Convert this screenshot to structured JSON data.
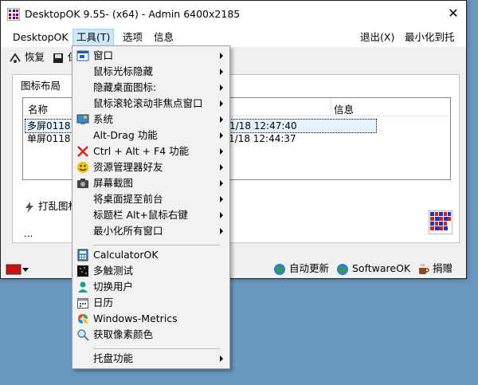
{
  "window": {
    "title": "DesktopOK 9.55- (x64) - Admin 6400x2185",
    "close_glyph": "✕"
  },
  "menubar": {
    "items": [
      "DesktopOK",
      "工具(T)",
      "选项",
      "信息"
    ],
    "right": [
      "退出(X)",
      "最小化到托盘"
    ]
  },
  "toolbar": {
    "restore": "恢复",
    "save_partial": "保"
  },
  "panel": {
    "title": "图标布局",
    "columns": [
      "名称",
      "信息"
    ],
    "rows": [
      {
        "name": "多屏0118",
        "date": "1/18 12:47:40"
      },
      {
        "name": "单屏0118",
        "date": "1/18 12:44:37"
      }
    ],
    "shuffle_partial": "打乱图标",
    "ellipsis": "..."
  },
  "status": {
    "auto_update": "自动更新",
    "softwareok": "SoftwareOK",
    "donate": "捐赠"
  },
  "menu": {
    "group1": [
      {
        "label": "窗口",
        "submenu": true,
        "icon": "window-icon"
      },
      {
        "label": "鼠标光标隐藏",
        "submenu": true,
        "icon": ""
      },
      {
        "label": "隐藏桌面图标:",
        "submenu": true,
        "icon": ""
      },
      {
        "label": "鼠标滚轮滚动非焦点窗口",
        "submenu": true,
        "icon": ""
      },
      {
        "label": "系统",
        "submenu": true,
        "icon": "system-icon"
      },
      {
        "label": "Alt-Drag 功能",
        "submenu": true,
        "icon": ""
      },
      {
        "label": "Ctrl + Alt + F4 功能",
        "submenu": true,
        "icon": "red-x-icon"
      },
      {
        "label": "资源管理器好友",
        "submenu": true,
        "icon": "explorer-friend-icon"
      },
      {
        "label": "屏幕截图",
        "submenu": true,
        "icon": "camera-icon"
      },
      {
        "label": "将桌面提至前台",
        "submenu": true,
        "icon": ""
      },
      {
        "label": "标题栏 Alt+鼠标右键",
        "submenu": true,
        "icon": ""
      },
      {
        "label": "最小化所有窗口",
        "submenu": true,
        "icon": ""
      }
    ],
    "group2": [
      {
        "label": "CalculatorOK",
        "icon": "calculator-icon"
      },
      {
        "label": "多触测试",
        "icon": "multitouch-icon"
      },
      {
        "label": "切换用户",
        "icon": "user-icon"
      },
      {
        "label": "日历",
        "icon": "calendar-icon"
      },
      {
        "label": "Windows-Metrics",
        "icon": "metrics-icon"
      },
      {
        "label": "获取像素颜色",
        "icon": "magnifier-icon"
      }
    ],
    "group3": [
      {
        "label": "托盘功能",
        "submenu": true,
        "icon": ""
      }
    ]
  }
}
